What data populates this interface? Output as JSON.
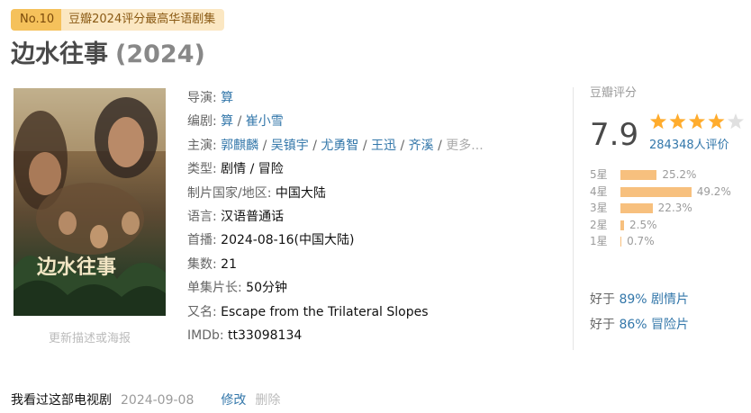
{
  "badge": {
    "rank": "No.10",
    "award": "豆瓣2024评分最高华语剧集"
  },
  "title": {
    "name": "边水往事",
    "year": "(2024)"
  },
  "poster": {
    "link": "更新描述或海报"
  },
  "info": {
    "director_label": "导演",
    "director": "算",
    "writer_label": "编剧",
    "writers": [
      "算",
      "崔小雪"
    ],
    "cast_label": "主演",
    "cast": [
      "郭麒麟",
      "吴镇宇",
      "尤勇智",
      "王迅",
      "齐溪"
    ],
    "cast_more": "更多...",
    "genre_label": "类型",
    "genres": "剧情 / 冒险",
    "region_label": "制片国家/地区",
    "region": "中国大陆",
    "language_label": "语言",
    "language": "汉语普通话",
    "premiere_label": "首播",
    "premiere": "2024-08-16(中国大陆)",
    "episodes_label": "集数",
    "episodes": "21",
    "runtime_label": "单集片长",
    "runtime": "50分钟",
    "aka_label": "又名",
    "aka": "Escape from the Trilateral Slopes",
    "imdb_label": "IMDb",
    "imdb": "tt33098134"
  },
  "rating": {
    "label": "豆瓣评分",
    "score": "7.9",
    "stars_value": 4,
    "stars_max": 5,
    "votes": "284348人评价",
    "distribution": [
      {
        "label": "5星",
        "percent": "25.2%",
        "value": 25.2
      },
      {
        "label": "4星",
        "percent": "49.2%",
        "value": 49.2
      },
      {
        "label": "3星",
        "percent": "22.3%",
        "value": 22.3
      },
      {
        "label": "2星",
        "percent": "2.5%",
        "value": 2.5
      },
      {
        "label": "1星",
        "percent": "0.7%",
        "value": 0.7
      }
    ],
    "better_than": [
      {
        "prefix": "好于",
        "percent": "89%",
        "genre": "剧情片"
      },
      {
        "prefix": "好于",
        "percent": "86%",
        "genre": "冒险片"
      }
    ]
  },
  "user": {
    "status": "我看过这部电视剧",
    "date": "2024-09-08",
    "edit": "修改",
    "delete": "删除"
  },
  "colors": {
    "link": "#3377aa",
    "star": "#ffac2d",
    "bar": "#f7c07e",
    "badge": "#f5c15b"
  }
}
